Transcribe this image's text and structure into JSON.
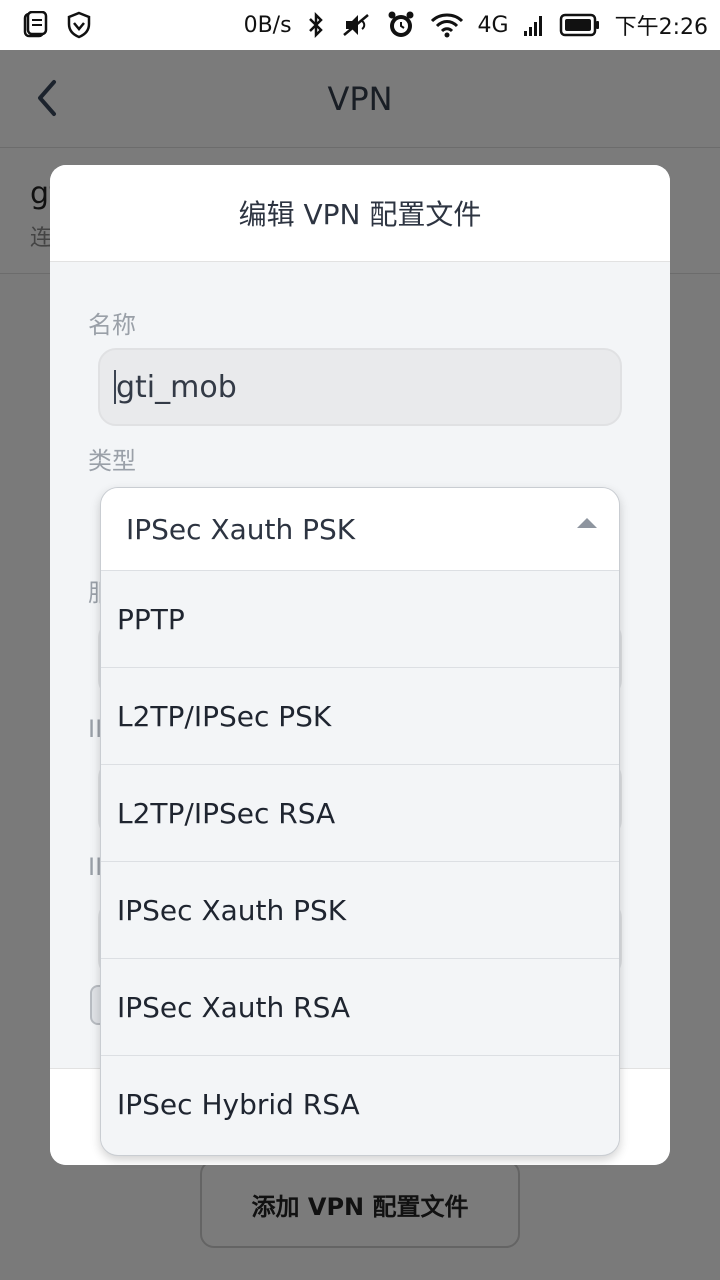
{
  "status_bar": {
    "net_speed": "0B/s",
    "network": "4G",
    "time": "下午2:26"
  },
  "page": {
    "title": "VPN",
    "list_item_title": "gti_mob",
    "list_item_subtitle": "连接",
    "add_button_label": "添加 VPN 配置文件"
  },
  "dialog": {
    "title": "编辑 VPN 配置文件",
    "name_label": "名称",
    "name_value": "gti_mob",
    "type_label": "类型",
    "server_label": "服",
    "ipsec_label_1": "II",
    "ipsec_label_2": "II"
  },
  "dropdown": {
    "selected": "IPSec Xauth PSK",
    "options": [
      "PPTP",
      "L2TP/IPSec PSK",
      "L2TP/IPSec RSA",
      "IPSec Xauth PSK",
      "IPSec Xauth RSA",
      "IPSec Hybrid RSA"
    ]
  }
}
